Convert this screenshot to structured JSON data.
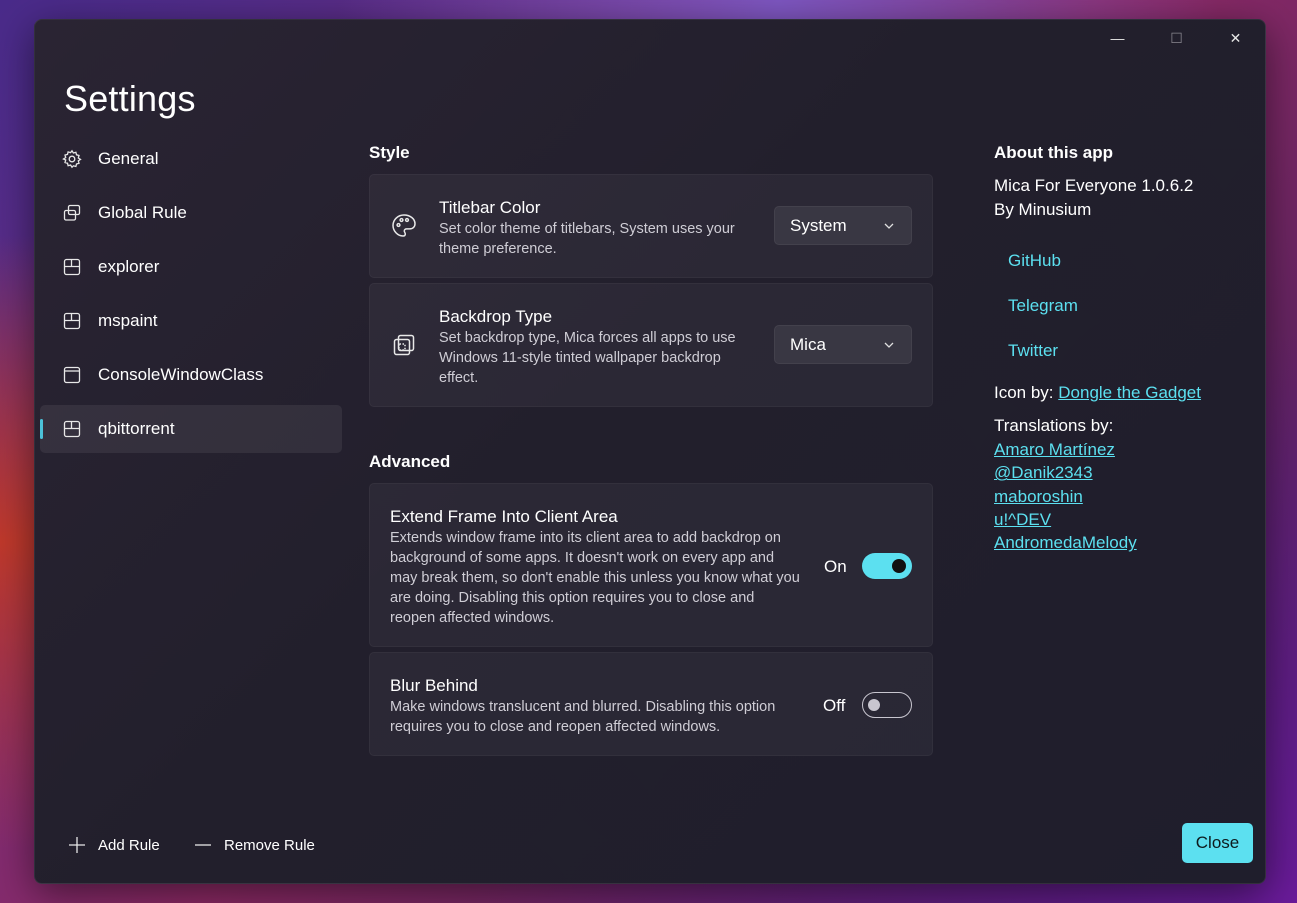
{
  "window": {
    "title": "Settings",
    "caption": {
      "minimize": "—",
      "maximize": "☐",
      "close": "✕"
    }
  },
  "sidebar": {
    "items": [
      {
        "label": "General",
        "icon": "gear-icon",
        "selected": false
      },
      {
        "label": "Global Rule",
        "icon": "overlap-windows-icon",
        "selected": false
      },
      {
        "label": "explorer",
        "icon": "app-window-icon",
        "selected": false
      },
      {
        "label": "mspaint",
        "icon": "app-window-icon",
        "selected": false
      },
      {
        "label": "ConsoleWindowClass",
        "icon": "window-icon",
        "selected": false
      },
      {
        "label": "qbittorrent",
        "icon": "app-window-icon",
        "selected": true
      }
    ]
  },
  "style_section": {
    "title": "Style",
    "titlebar_color": {
      "title": "Titlebar Color",
      "description": "Set color theme of titlebars, System uses your theme preference.",
      "value": "System",
      "icon": "palette-icon"
    },
    "backdrop_type": {
      "title": "Backdrop Type",
      "description": "Set backdrop type, Mica forces all apps to use Windows 11-style tinted wallpaper backdrop effect.",
      "value": "Mica",
      "icon": "backdrop-icon"
    }
  },
  "advanced_section": {
    "title": "Advanced",
    "extend_frame": {
      "title": "Extend Frame Into Client Area",
      "description": "Extends window frame into its client area to add backdrop on background of some apps. It doesn't work on every app and may break them, so don't enable this unless you know what you are doing. Disabling this option requires you to close and reopen affected windows.",
      "state_label": "On",
      "enabled": true
    },
    "blur_behind": {
      "title": "Blur Behind",
      "description": "Make windows translucent and blurred. Disabling this option requires you to close and reopen affected windows.",
      "state_label": "Off",
      "enabled": false
    }
  },
  "about": {
    "title": "About this app",
    "app_name": "Mica For Everyone 1.0.6.2",
    "author": "By Minusium",
    "links": [
      "GitHub",
      "Telegram",
      "Twitter"
    ],
    "icon_by_prefix": "Icon by: ",
    "icon_by_name": "Dongle the Gadget",
    "translations_title": "Translations by:",
    "translators": [
      "Amaro Martínez",
      "@Danik2343",
      "maboroshin",
      "u!^DEV",
      "AndromedaMelody"
    ]
  },
  "footer": {
    "add_rule": "Add Rule",
    "remove_rule": "Remove Rule",
    "close": "Close"
  },
  "colors": {
    "accent": "#5ce0f0",
    "selection_indicator": "#4cc2d9"
  }
}
